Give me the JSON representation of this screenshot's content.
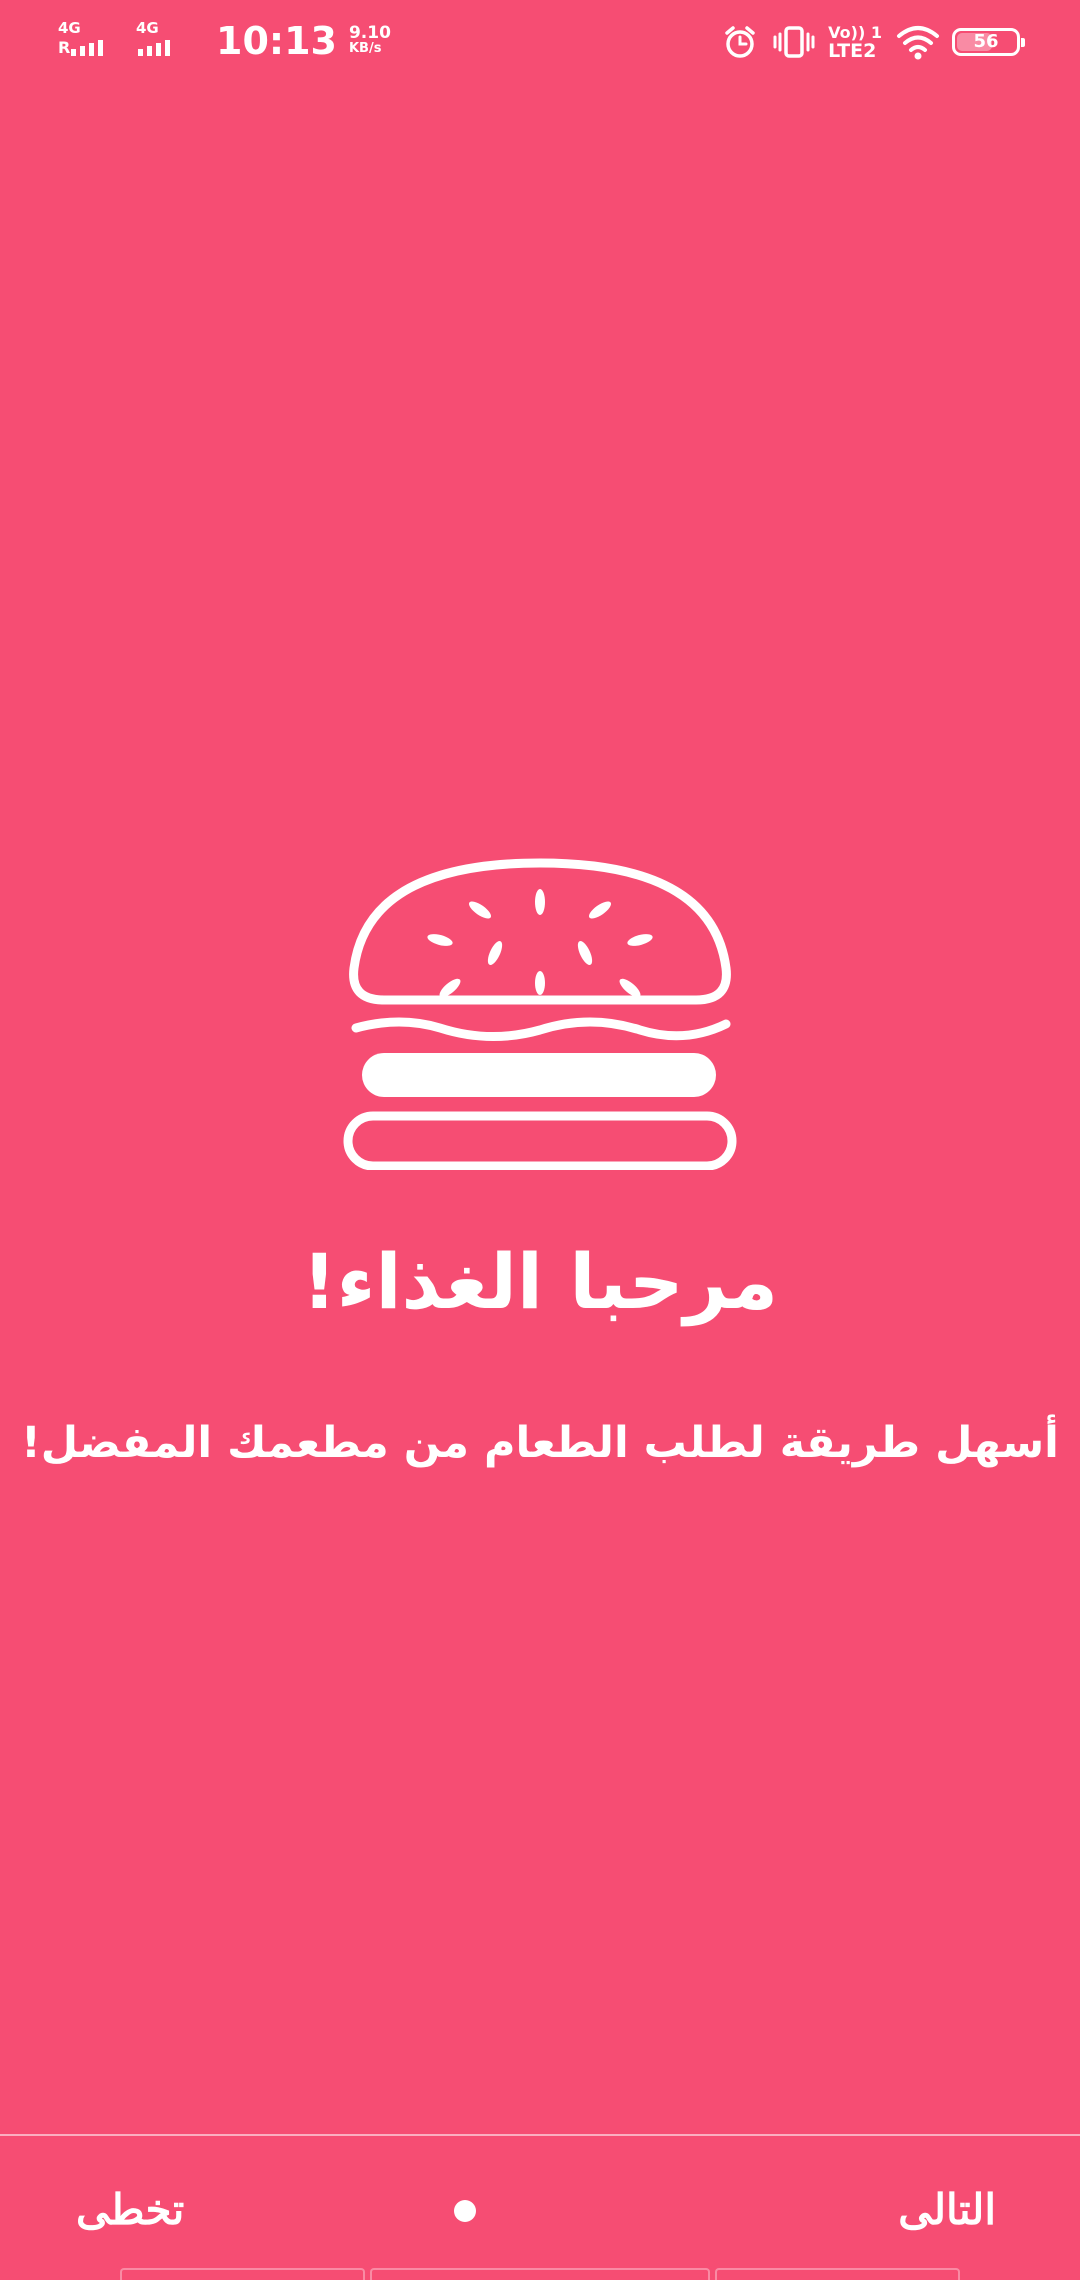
{
  "status_bar": {
    "network_1": "4G",
    "roaming": "R",
    "network_2": "4G",
    "time": "10:13",
    "speed_value": "9.10",
    "speed_unit": "KB/s",
    "volte_top": "Vo)) 1",
    "volte_bottom": "LTE2",
    "battery_level": "56",
    "icons": [
      "alarm-icon",
      "vibrate-icon",
      "wifi-icon",
      "battery-icon"
    ]
  },
  "onboarding": {
    "illustration": "burger-icon",
    "title": "مرحبا الغذاء!",
    "subtitle": "أسهل طريقة لطلب الطعام من مطعمك المفضل!"
  },
  "footer": {
    "skip_label": "تخطى",
    "next_label": "التالى",
    "page_indicator": {
      "current": 1,
      "total": 1
    }
  },
  "colors": {
    "background": "#F64D73",
    "foreground": "#FFFFFF"
  }
}
